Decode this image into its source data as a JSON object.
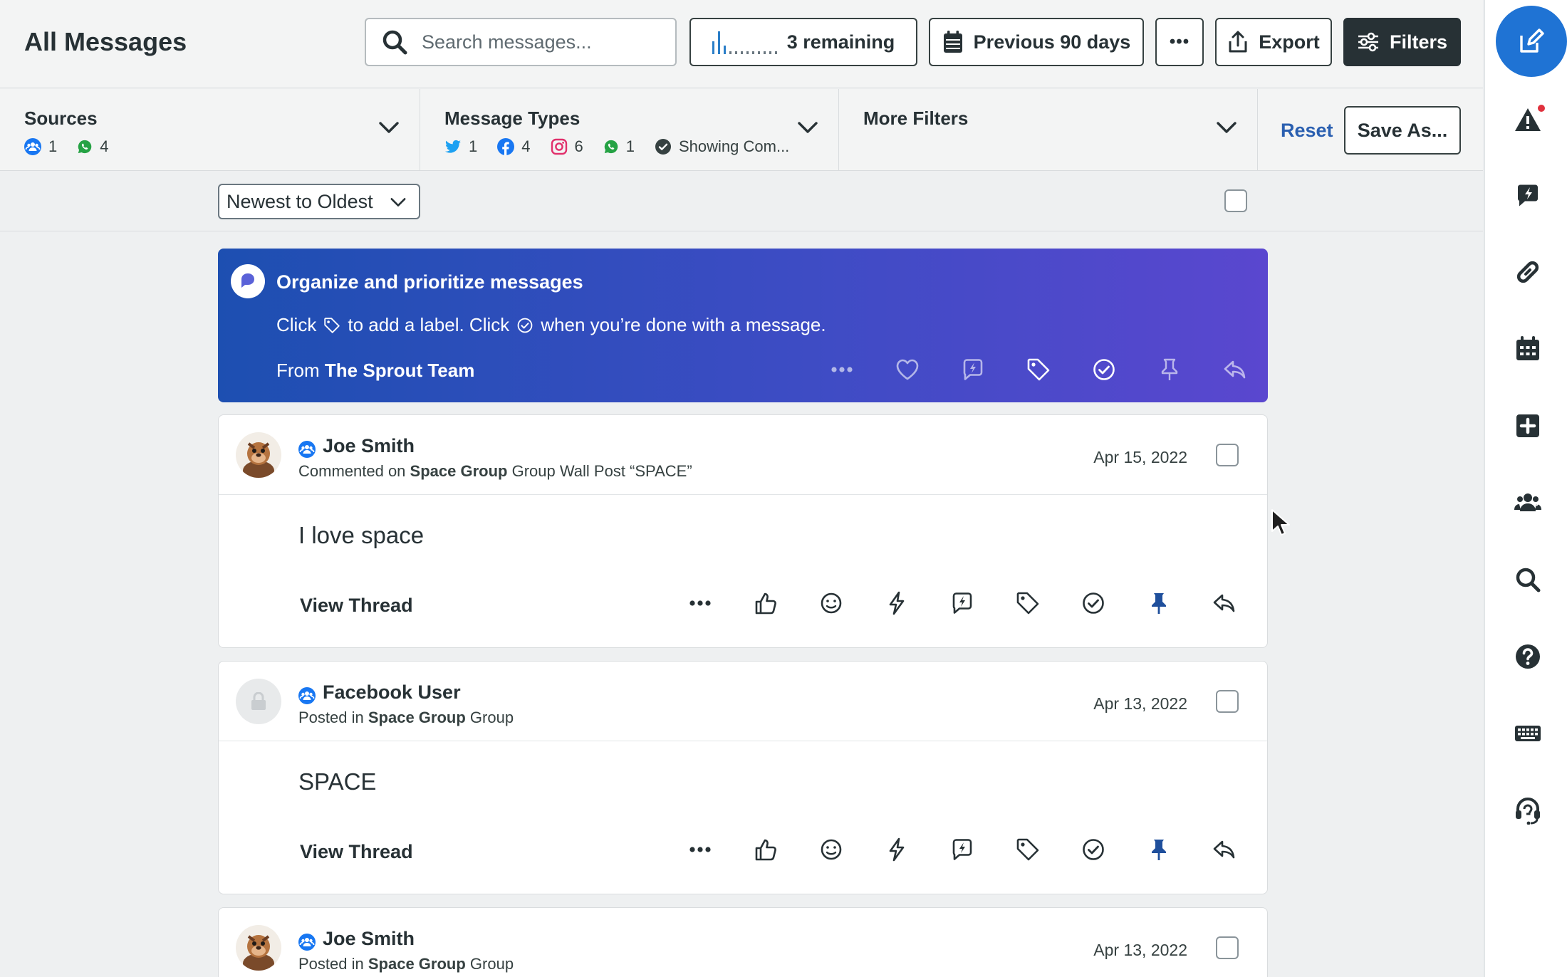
{
  "header": {
    "title": "All Messages",
    "search_placeholder": "Search messages...",
    "remaining_label": "3 remaining",
    "date_range_label": "Previous 90 days",
    "more_label": "•••",
    "export_label": "Export",
    "filters_label": "Filters"
  },
  "filters": {
    "sources": {
      "label": "Sources",
      "groups_count": "1",
      "whatsapp_count": "4"
    },
    "message_types": {
      "label": "Message Types",
      "twitter_count": "1",
      "facebook_count": "4",
      "instagram_count": "6",
      "whatsapp_count": "1",
      "completed_label": "Showing Com..."
    },
    "more_filters": {
      "label": "More Filters"
    },
    "reset_label": "Reset",
    "save_as_label": "Save As..."
  },
  "sort": {
    "selected": "Newest to Oldest"
  },
  "promo": {
    "title": "Organize and prioritize messages",
    "desc_part1": "Click",
    "desc_part2": "to add a label. Click",
    "desc_part3": "when you’re done with a message.",
    "from_prefix": "From",
    "from_name": "The Sprout Team",
    "more_label": "•••"
  },
  "messages": [
    {
      "author": "Joe Smith",
      "meta_prefix": "Commented on",
      "meta_group": "Space Group",
      "meta_suffix": "Group Wall Post “SPACE”",
      "date": "Apr 15, 2022",
      "text": "I love space",
      "view_thread": "View Thread",
      "more_label": "•••"
    },
    {
      "author": "Facebook User",
      "meta_prefix": "Posted in",
      "meta_group": "Space Group",
      "meta_suffix": "Group",
      "date": "Apr 13, 2022",
      "text": "SPACE",
      "view_thread": "View Thread",
      "more_label": "•••"
    },
    {
      "author": "Joe Smith",
      "meta_prefix": "Posted in",
      "meta_group": "Space Group",
      "meta_suffix": "Group",
      "date": "Apr 13, 2022"
    }
  ],
  "colors": {
    "accent_blue": "#1f73d4",
    "pin_blue": "#1f4f9c",
    "banner_start": "#1d4fb1",
    "banner_end": "#5a47cf",
    "alert_red": "#e0313d",
    "whatsapp_green": "#25a244",
    "instagram_red": "#e1306c",
    "twitter_blue": "#1da1f2",
    "facebook_blue": "#1877f2"
  },
  "rail_icons": [
    "compose-icon",
    "alert-icon",
    "reply-bolt-icon",
    "link-icon",
    "calendar-icon",
    "add-icon",
    "people-icon",
    "search-icon",
    "help-icon",
    "keyboard-icon",
    "headset-icon"
  ]
}
